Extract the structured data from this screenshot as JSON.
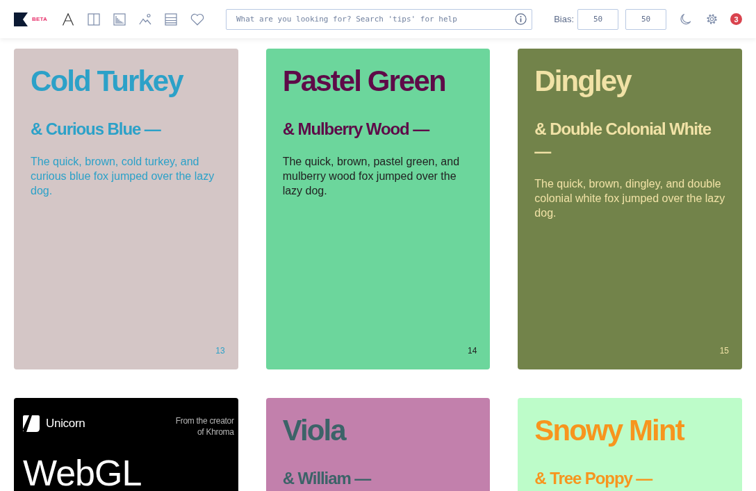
{
  "header": {
    "logo": {
      "badge": "BETA"
    },
    "search": {
      "placeholder": "What are you looking for? Search 'tips' for help"
    },
    "bias": {
      "label": "Bias:",
      "values": [
        "50",
        "50"
      ]
    },
    "notifications": {
      "count": "3"
    }
  },
  "cards": [
    {
      "kind": "palette",
      "color": "#d4c6c6",
      "title": {
        "text": "Cold Turkey",
        "color": "#2ca1c8"
      },
      "subtitle": {
        "text": "& Curious Blue —",
        "color": "#2ca1c8"
      },
      "sample": {
        "text": "The quick, brown, cold turkey, and curious blue fox jumped over the lazy dog.",
        "color": "#2ca1c8"
      },
      "number": {
        "text": "13",
        "color": "#2ca1c8"
      }
    },
    {
      "kind": "palette",
      "color": "#6cd69c",
      "title": {
        "text": "Pastel Green",
        "color": "#5e0a48"
      },
      "subtitle": {
        "text": "& Mulberry Wood —",
        "color": "#5e0a48"
      },
      "sample": {
        "text": "The quick, brown, pastel green, and mulberry wood fox jumped over the lazy dog.",
        "color": "#222222"
      },
      "number": {
        "text": "14",
        "color": "#222222"
      }
    },
    {
      "kind": "palette",
      "color": "#72834a",
      "title": {
        "text": "Dingley",
        "color": "#f1e2a6"
      },
      "subtitle": {
        "text": "& Double Colonial White —",
        "color": "#f1e2a6"
      },
      "sample": {
        "text": "The quick, brown, dingley, and double colonial white fox jumped over the lazy dog.",
        "color": "#f1e2a6"
      },
      "number": {
        "text": "15",
        "color": "#f1e2a6"
      }
    },
    {
      "kind": "ad",
      "brand": "Unicorn",
      "tagline": "From the creator of Khroma",
      "headline": "WebGL"
    },
    {
      "kind": "palette",
      "color": "#c280ac",
      "title": {
        "text": "Viola",
        "color": "#3c6368"
      },
      "subtitle": {
        "text": "& William —",
        "color": "#3c6368"
      }
    },
    {
      "kind": "palette",
      "color": "#bdfcc9",
      "title": {
        "text": "Snowy Mint",
        "color": "#f7951e"
      },
      "subtitle": {
        "text": "& Tree Poppy —",
        "color": "#f7951e"
      }
    }
  ]
}
